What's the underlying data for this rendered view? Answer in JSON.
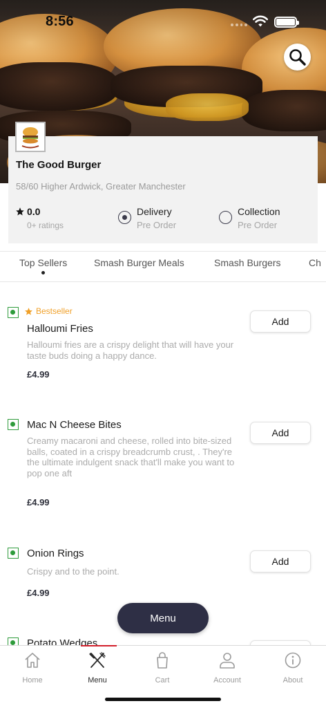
{
  "status_bar": {
    "time": "8:56"
  },
  "restaurant": {
    "name": "The Good Burger",
    "address": "58/60 Higher Ardwick, Greater Manchester",
    "rating": "0.0",
    "ratings_count": "0+ ratings",
    "logo_text": "The Good Burger"
  },
  "order_options": [
    {
      "label": "Delivery",
      "sub": "Pre Order",
      "selected": true
    },
    {
      "label": "Collection",
      "sub": "Pre Order",
      "selected": false
    }
  ],
  "categories": [
    "Top Sellers",
    "Smash Burger Meals",
    "Smash Burgers",
    "Ch"
  ],
  "active_category": "Top Sellers",
  "items": [
    {
      "badge": "Bestseller",
      "name": "Halloumi Fries",
      "description": "Halloumi fries are a crispy delight that will have your taste buds doing a happy dance.",
      "price": "£4.99",
      "button": "Add"
    },
    {
      "name": "Mac N Cheese Bites",
      "description": "Creamy macaroni and cheese, rolled into bite-sized balls, coated in a crispy breadcrumb crust, . They're the ultimate indulgent snack that'll make you want to pop one aft",
      "price": "£4.99",
      "button": "Add"
    },
    {
      "name": "Onion Rings",
      "description": "Crispy and to the point.",
      "price": "£4.99",
      "button": "Add"
    },
    {
      "name": "Potato Wedges"
    }
  ],
  "menu_button": "Menu",
  "nav": [
    {
      "label": "Home",
      "icon": "home-icon"
    },
    {
      "label": "Menu",
      "icon": "cutlery-icon",
      "active": true
    },
    {
      "label": "Cart",
      "icon": "bag-icon"
    },
    {
      "label": "Account",
      "icon": "user-icon"
    },
    {
      "label": "About",
      "icon": "info-icon"
    }
  ],
  "colors": {
    "accent": "#2e2f45",
    "veg": "#2e9b3b",
    "bestseller": "#f0a028",
    "nav_indicator": "#d21f2b"
  }
}
